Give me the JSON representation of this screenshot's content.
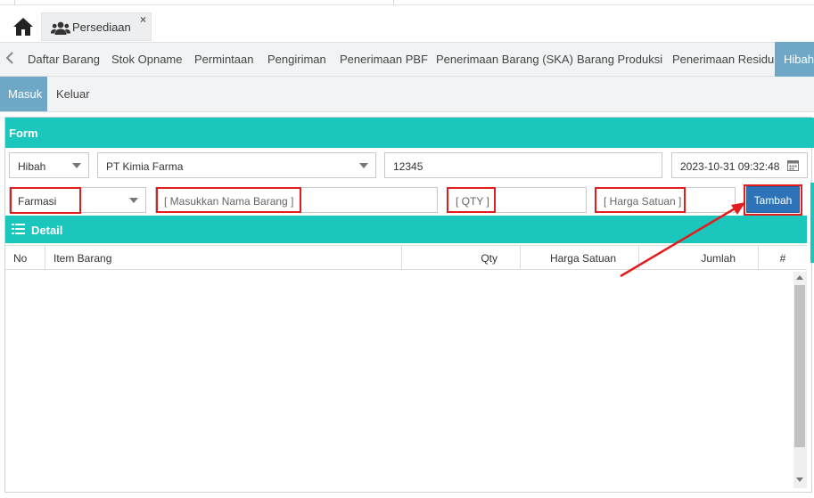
{
  "app_tabs": [
    {
      "label": "Persediaan",
      "close_glyph": "×"
    }
  ],
  "icons": {
    "home": "home-icon",
    "users": "users-icon",
    "close": "close-icon",
    "nav_left": "chevron-left-icon",
    "caret": "caret-down-icon",
    "calendar": "calendar-icon",
    "list": "list-icon"
  },
  "nav": {
    "items": [
      "Daftar Barang",
      "Stok Opname",
      "Permintaan",
      "Pengiriman",
      "Penerimaan PBF",
      "Penerimaan Barang (SKA)",
      "Barang Produksi",
      "Penerimaan Residu"
    ],
    "active": "Hibah"
  },
  "subtabs": {
    "active": "Masuk",
    "other": "Keluar"
  },
  "form": {
    "title": "Form",
    "type_select": "Hibah",
    "supplier_select": "PT Kimia Farma",
    "number_field": "12345",
    "datetime_field": "2023-10-31 09:32:48",
    "category_select": "Farmasi",
    "item_placeholder": "[ Masukkan Nama Barang ]",
    "qty_placeholder": "[ QTY ]",
    "price_placeholder": "[ Harga Satuan ]",
    "add_button": "Tambah"
  },
  "detail": {
    "title": "Detail",
    "columns": [
      "No",
      "Item Barang",
      "Qty",
      "Harga Satuan",
      "Jumlah",
      "#"
    ]
  },
  "colors": {
    "accent_teal": "#1bc6bc",
    "active_tab": "#6fa8c7",
    "button_blue": "#2e73b8",
    "highlight_red": "#e31d1d"
  }
}
